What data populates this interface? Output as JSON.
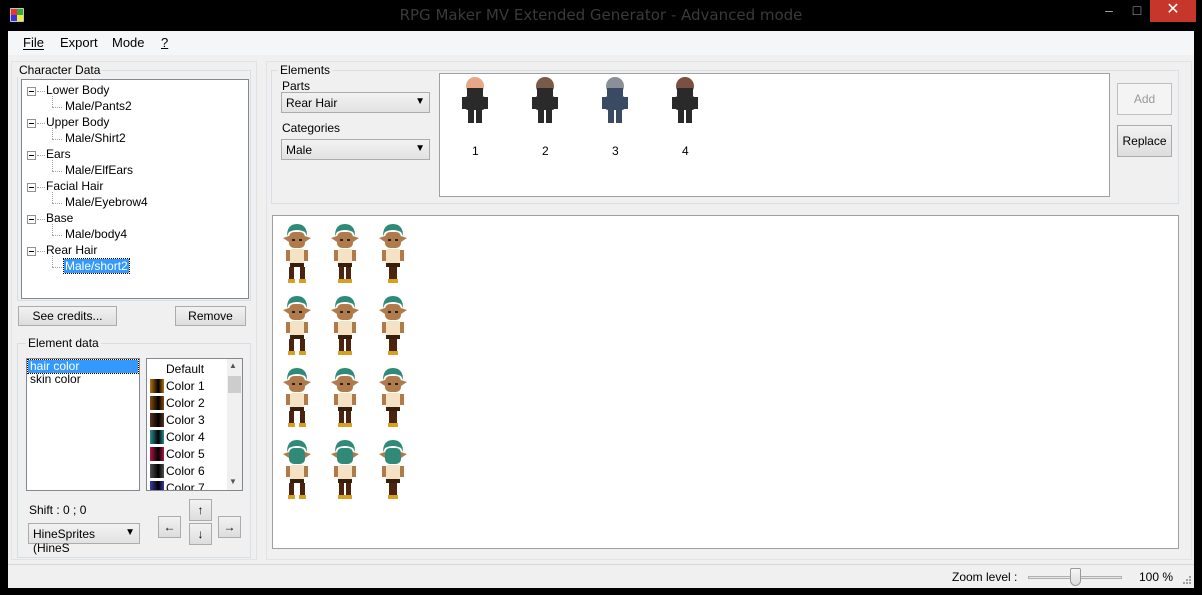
{
  "window": {
    "title": "RPG Maker MV Extended Generator - Advanced mode",
    "minimize": "–",
    "maximize": "□",
    "close": "✕"
  },
  "menu": {
    "file": "File",
    "export": "Export",
    "mode": "Mode",
    "help": "?"
  },
  "character_data": {
    "label": "Character Data",
    "tree": [
      {
        "category": "Lower Body",
        "item": "Male/Pants2"
      },
      {
        "category": "Upper Body",
        "item": "Male/Shirt2"
      },
      {
        "category": "Ears",
        "item": "Male/ElfEars"
      },
      {
        "category": "Facial Hair",
        "item": "Male/Eyebrow4"
      },
      {
        "category": "Base",
        "item": "Male/body4"
      },
      {
        "category": "Rear Hair",
        "item": "Male/short2"
      }
    ],
    "see_credits": "See credits...",
    "remove": "Remove"
  },
  "element_data": {
    "label": "Element data",
    "properties": [
      "hair color",
      "skin color"
    ],
    "colors": [
      {
        "name": "Default",
        "color": ""
      },
      {
        "name": "Color 1",
        "color": "#b8720f"
      },
      {
        "name": "Color 2",
        "color": "#8a4b12"
      },
      {
        "name": "Color 3",
        "color": "#5a3420"
      },
      {
        "name": "Color 4",
        "color": "#2a8e94"
      },
      {
        "name": "Color 5",
        "color": "#b01846"
      },
      {
        "name": "Color 6",
        "color": "#505050"
      },
      {
        "name": "Color 7",
        "color": "#3a3aa8"
      }
    ],
    "shift": "Shift : 0 ; 0",
    "source": "HineSprites (HineS",
    "up": "↑",
    "down": "↓",
    "left": "←",
    "right": "→"
  },
  "elements": {
    "label": "Elements",
    "parts_label": "Parts",
    "parts_value": "Rear Hair",
    "categories_label": "Categories",
    "categories_value": "Male",
    "previews": [
      {
        "label": "1",
        "hair": "#e8a888"
      },
      {
        "label": "2",
        "hair": "#7a5a48"
      },
      {
        "label": "3",
        "hair": "#8a8f98"
      },
      {
        "label": "4",
        "hair": "#7a5040"
      }
    ],
    "add": "Add",
    "replace": "Replace"
  },
  "status": {
    "zoom_label": "Zoom level :",
    "zoom_value": "100 %",
    "zoom_fraction": 0.5
  },
  "colors": {
    "hair": "#2f8a78",
    "skin": "#b07a4a",
    "shirt": "#f4e2c4",
    "pants": "#4a2410"
  }
}
